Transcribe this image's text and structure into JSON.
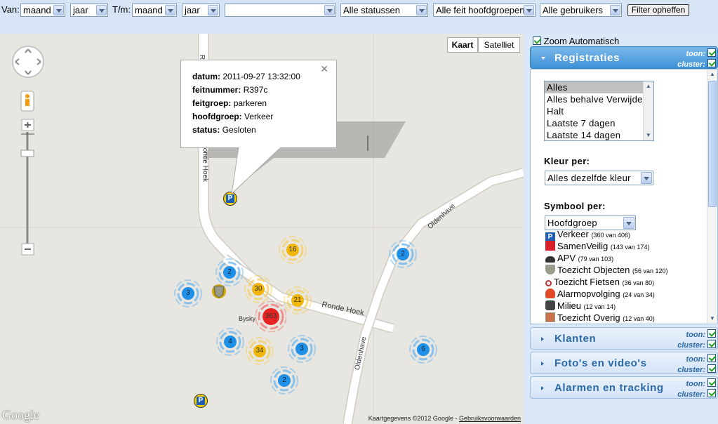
{
  "filters": {
    "van_label": "Van:",
    "van_month": "maand",
    "van_year": "jaar",
    "tm_label": "T/m:",
    "tm_month": "maand",
    "tm_year": "jaar",
    "blank": "",
    "status": "Alle statussen",
    "hoofdgroep": "Alle feit hoofdgroepen",
    "gebruikers": "Alle gebruikers",
    "clear_button": "Filter opheffen"
  },
  "map": {
    "type_map": "Kaart",
    "type_satellite": "Satelliet",
    "roads": {
      "ronde_hoek_vertical_top": "R",
      "ronde_hoek_vertical": "Ronde Hoek",
      "ronde_hoek_horizontal": "Ronde Hoek",
      "oldenhave_top": "Oldenhave",
      "oldenhave_bottom": "Oldenhave",
      "bysky": "Bysky"
    },
    "clusters": [
      {
        "count": "16",
        "color": "orange"
      },
      {
        "count": "2",
        "color": "blue"
      },
      {
        "count": "30",
        "color": "orange"
      },
      {
        "count": "3",
        "color": "blue"
      },
      {
        "count": "21",
        "color": "orange"
      },
      {
        "count": "363",
        "color": "red"
      },
      {
        "count": "2",
        "color": "blue"
      },
      {
        "count": "4",
        "color": "blue"
      },
      {
        "count": "34",
        "color": "orange"
      },
      {
        "count": "3",
        "color": "blue"
      },
      {
        "count": "6",
        "color": "blue"
      },
      {
        "count": "2",
        "color": "blue"
      }
    ],
    "infowindow": {
      "datum_label": "datum:",
      "datum": "2011-09-27 13:32:00",
      "feitnummer_label": "feitnummer:",
      "feitnummer": "R397c",
      "feitgroep_label": "feitgroep:",
      "feitgroep": "parkeren",
      "hoofdgroep_label": "hoofdgroep:",
      "hoofdgroep": "Verkeer",
      "status_label": "status:",
      "status": "Gesloten"
    },
    "footer_text": "Kaartgegevens ©2012 Google - ",
    "footer_link": "Gebruiksvoorwaarden",
    "logo": "Google"
  },
  "panel": {
    "zoom_auto": "Zoom Automatisch",
    "toon": "toon:",
    "cluster": "cluster:",
    "sections": {
      "registraties": "Registraties",
      "klanten": "Klanten",
      "fotos": "Foto's en video's",
      "alarmen": "Alarmen en tracking"
    },
    "period_options": [
      "Alles",
      "Alles behalve Verwijderd",
      "Halt",
      "Laatste 7 dagen",
      "Laatste 14 dagen"
    ],
    "kleur_label": "Kleur per:",
    "kleur_value": "Alles dezelfde kleur",
    "symbool_label": "Symbool per:",
    "symbool_value": "Hoofdgroep",
    "symbols": [
      {
        "name": "Verkeer",
        "count": "(360 van 406)",
        "icon": "parking-icon"
      },
      {
        "name": "SamenVeilig",
        "count": "(143 van 174)",
        "icon": "samenveilig-icon"
      },
      {
        "name": "APV",
        "count": "(79 van 103)",
        "icon": "police-cap-icon"
      },
      {
        "name": "Toezicht Objecten",
        "count": "(56 van 120)",
        "icon": "shield-icon"
      },
      {
        "name": "Toezicht Fietsen",
        "count": "(36 van 80)",
        "icon": "bicycle-icon"
      },
      {
        "name": "Alarmopvolging",
        "count": "(24 van 34)",
        "icon": "alarm-bell-icon"
      },
      {
        "name": "Milieu",
        "count": "(12 van 14)",
        "icon": "environment-icon"
      },
      {
        "name": "Toezicht Overig",
        "count": "(12 van 40)",
        "icon": "other-icon"
      }
    ]
  }
}
